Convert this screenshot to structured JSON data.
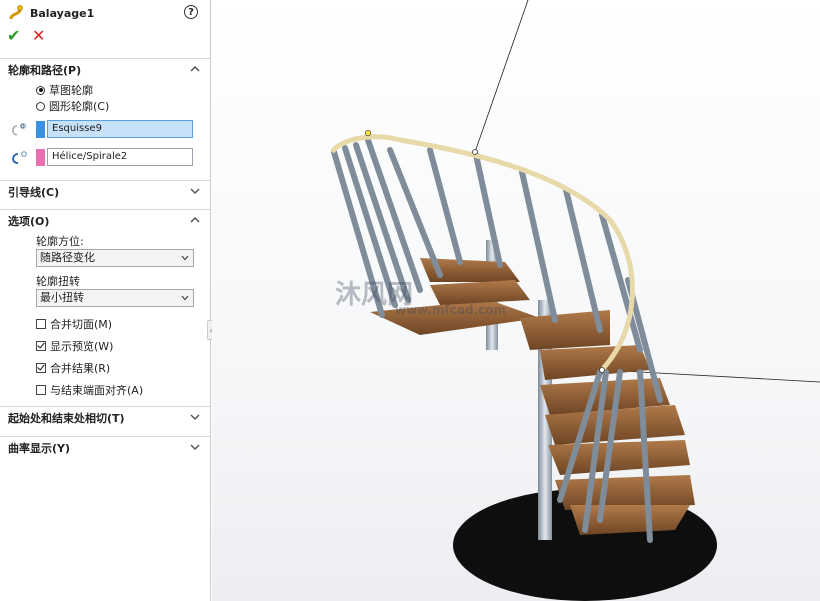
{
  "panel": {
    "feature_name": "Balayage1",
    "help_glyph": "?",
    "ok_glyph": "✔",
    "cancel_glyph": "✕",
    "sections": {
      "profile_path": {
        "label": "轮廓和路径(P)",
        "radio_sketch": "草图轮廓",
        "radio_circular": "圆形轮廓(C)",
        "profile_value": "Esquisse9",
        "path_value": "Hélice/Spirale2",
        "profile_color": "#3b8fe0",
        "path_color": "#e870b0"
      },
      "guide_curves": {
        "label": "引导线(C)"
      },
      "options": {
        "label": "选项(O)",
        "orientation_label": "轮廓方位:",
        "orientation_value": "随路径变化",
        "twist_label": "轮廓扭转",
        "twist_value": "最小扭转",
        "merge_tangent": "合并切面(M)",
        "show_preview": "显示预览(W)",
        "merge_result": "合并结果(R)",
        "align_end": "与结束端面对齐(A)"
      },
      "start_end": {
        "label": "起始处和结束处相切(T)"
      },
      "curvature": {
        "label": "曲率显示(Y)"
      }
    }
  },
  "viewport": {
    "watermark": "沐风网",
    "watermark_sub": "www.mfcad.com"
  }
}
